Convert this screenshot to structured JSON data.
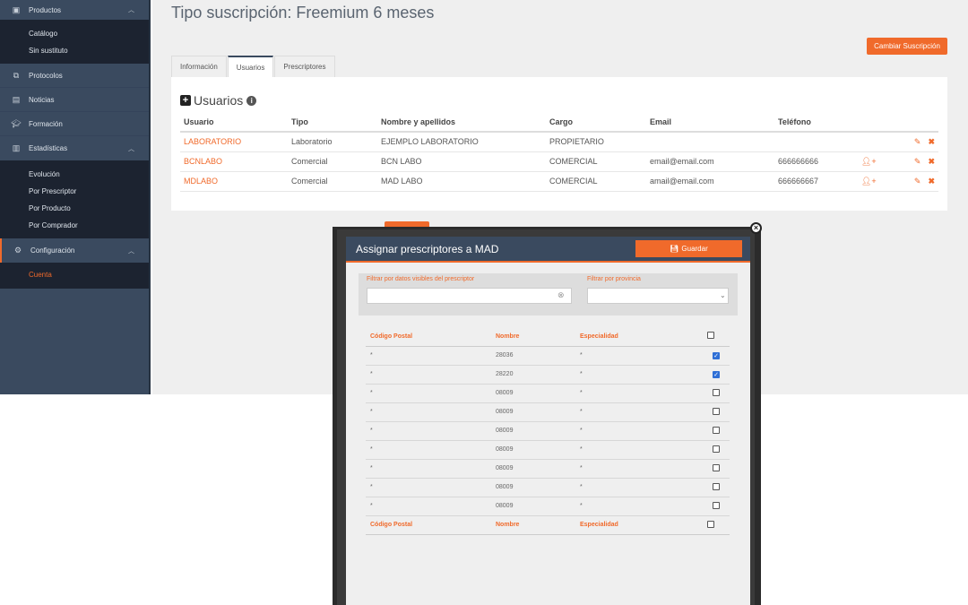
{
  "sidebar": {
    "productos": {
      "label": "Productos",
      "children": [
        "Catálogo",
        "Sin sustituto"
      ]
    },
    "items": [
      {
        "label": "Protocolos",
        "icon": "protocol-icon"
      },
      {
        "label": "Noticias",
        "icon": "news-icon"
      },
      {
        "label": "Formación",
        "icon": "graduation-icon"
      }
    ],
    "estadisticas": {
      "label": "Estadísticas",
      "children": [
        "Evolución",
        "Por Prescriptor",
        "Por Producto",
        "Por Comprador"
      ]
    },
    "configuracion": {
      "label": "Configuración",
      "children": [
        "Cuenta"
      ]
    }
  },
  "page": {
    "title": "Tipo suscripción: Freemium 6 meses",
    "change_button": "Cambiar Suscripción",
    "tabs": [
      "Información",
      "Usuarios",
      "Prescriptores"
    ],
    "active_tab": "Usuarios"
  },
  "users": {
    "heading": "Usuarios",
    "columns": [
      "Usuario",
      "Tipo",
      "Nombre y apellidos",
      "Cargo",
      "Email",
      "Teléfono"
    ],
    "rows": [
      {
        "usuario": "LABORATORIO",
        "tipo": "Laboratorio",
        "nombre": "EJEMPLO LABORATORIO",
        "cargo": "PROPIETARIO",
        "email": "",
        "telefono": "",
        "assign": false
      },
      {
        "usuario": "BCNLABO",
        "tipo": "Comercial",
        "nombre": "BCN LABO",
        "cargo": "COMERCIAL",
        "email": "email@email.com",
        "telefono": "666666666",
        "assign": true
      },
      {
        "usuario": "MDLABO",
        "tipo": "Comercial",
        "nombre": "MAD LABO",
        "cargo": "COMERCIAL",
        "email": "amail@email.com",
        "telefono": "666666667",
        "assign": true
      }
    ]
  },
  "modal": {
    "title": "Assignar prescriptores a MAD",
    "save_label": "Guardar",
    "filter_label": "Filtrar por datos visibles del prescriptor",
    "province_label": "Filtrar por provincia",
    "filter_value": "",
    "province_value": "",
    "columns": [
      "Código Postal",
      "Nombre",
      "Especialidad"
    ],
    "rows": [
      {
        "cp": "*",
        "nombre": "28036",
        "esp": "*",
        "checked": true
      },
      {
        "cp": "*",
        "nombre": "28220",
        "esp": "*",
        "checked": true
      },
      {
        "cp": "*",
        "nombre": "08009",
        "esp": "*",
        "checked": false
      },
      {
        "cp": "*",
        "nombre": "08009",
        "esp": "*",
        "checked": false
      },
      {
        "cp": "*",
        "nombre": "08009",
        "esp": "*",
        "checked": false
      },
      {
        "cp": "*",
        "nombre": "08009",
        "esp": "*",
        "checked": false
      },
      {
        "cp": "*",
        "nombre": "08009",
        "esp": "*",
        "checked": false
      },
      {
        "cp": "*",
        "nombre": "08009",
        "esp": "*",
        "checked": false
      },
      {
        "cp": "*",
        "nombre": "08009",
        "esp": "*",
        "checked": false
      }
    ]
  },
  "colors": {
    "accent": "#f06a2b",
    "sidebar": "#3a4a5f",
    "sidebar_dark": "#1c2330"
  }
}
